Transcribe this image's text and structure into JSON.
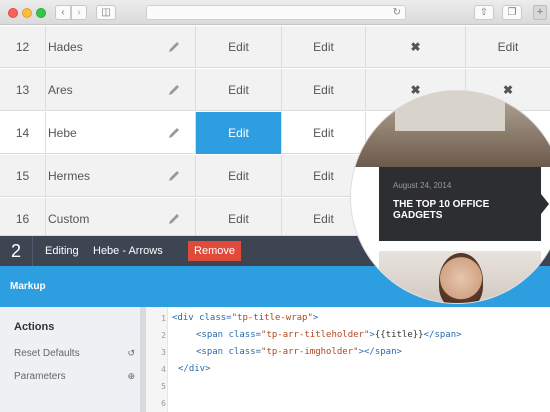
{
  "browser": {
    "back_icon": "chevron-left-icon",
    "forward_icon": "chevron-right-icon",
    "sidebar_icon": "sidebar-icon",
    "reload_icon": "reload-icon",
    "share_icon": "share-icon",
    "tabs_icon": "tabs-icon",
    "new_tab_label": "+"
  },
  "table": {
    "rows": [
      {
        "num": "12",
        "name": "Hades",
        "edit1": "Edit",
        "edit2": "Edit",
        "x": "✖",
        "edit3": "Edit"
      },
      {
        "num": "13",
        "name": "Ares",
        "edit1": "Edit",
        "edit2": "Edit",
        "x": "✖",
        "edit3": "✖"
      },
      {
        "num": "14",
        "name": "Hebe",
        "edit1": "Edit",
        "edit2": "Edit",
        "x": "",
        "edit3": ""
      },
      {
        "num": "15",
        "name": "Hermes",
        "edit1": "Edit",
        "edit2": "Edit",
        "x": "",
        "edit3": ""
      },
      {
        "num": "16",
        "name": "Custom",
        "edit1": "Edit",
        "edit2": "Edit",
        "x": "",
        "edit3": ""
      }
    ]
  },
  "editor": {
    "slide_number": "2",
    "editing_label": "Editing",
    "layer_name": "Hebe - Arrows",
    "remove_label": "Remove",
    "markup_label": "Markup"
  },
  "actions": {
    "title": "Actions",
    "items": [
      {
        "label": "Reset Defaults",
        "icon": "history-icon"
      },
      {
        "label": "Parameters",
        "icon": "plus-circle-icon"
      }
    ]
  },
  "code": {
    "line_numbers": [
      "1",
      "2",
      "3",
      "4",
      "5",
      "6"
    ],
    "lines": [
      {
        "t1": "<div ",
        "a1": "class=",
        "s1": "\"tp-title-wrap\"",
        "t2": ">",
        "tx": "",
        "t3": ""
      },
      {
        "t1": "<span ",
        "a1": "class=",
        "s1": "\"tp-arr-titleholder\"",
        "t2": ">",
        "tx": "{{title}}",
        "t3": "</span>"
      },
      {
        "t1": "<span ",
        "a1": "class=",
        "s1": "\"tp-arr-imgholder\"",
        "t2": "></span>",
        "tx": "",
        "t3": ""
      },
      {
        "t1": "</div>",
        "a1": "",
        "s1": "",
        "t2": "",
        "tx": "",
        "t3": ""
      }
    ]
  },
  "preview": {
    "date": "August 24, 2014",
    "title": "THE TOP 10 OFFICE GADGETS"
  },
  "colors": {
    "accent": "#2d9ee0",
    "editbar": "#3d4452",
    "remove": "#e04a3b"
  }
}
